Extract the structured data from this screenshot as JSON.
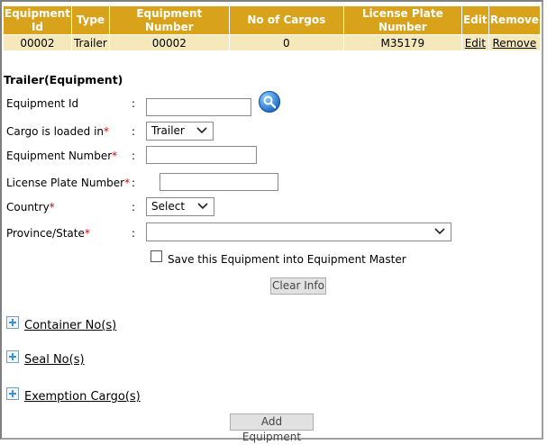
{
  "table": {
    "headers": [
      "Equipment Id",
      "Type",
      "Equipment Number",
      "No of Cargos",
      "License Plate Number",
      "Edit",
      "Remove"
    ],
    "rows": [
      {
        "equipment_id": "00002",
        "type": "Trailer",
        "equipment_number": "00002",
        "no_of_cargos": "0",
        "license_plate": "M35179",
        "edit": "Edit",
        "remove": "Remove"
      }
    ]
  },
  "form": {
    "title": "Trailer(Equipment)",
    "equipment_id_label": "Equipment Id",
    "cargo_loaded_label": "Cargo is loaded in",
    "cargo_loaded_value": "Trailer",
    "equipment_number_label": "Equipment Number",
    "license_plate_label": "License Plate Number",
    "country_label": "Country",
    "country_value": "Select",
    "province_label": "Province/State",
    "province_value": "",
    "required_mark": "*",
    "colon": ":",
    "save_checkbox_label": "Save this Equipment into Equipment Master",
    "clear_button": "Clear Info"
  },
  "sections": {
    "container": "Container No(s)",
    "seal": "Seal No(s)",
    "exemption": "Exemption Cargo(s)"
  },
  "add_button": "Add Equipment",
  "colors": {
    "header_bg": "#d9a21b",
    "row_bg": "#f5e9bc",
    "required": "#e00000"
  }
}
